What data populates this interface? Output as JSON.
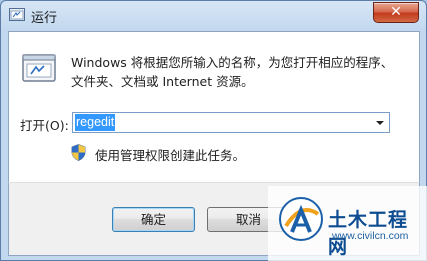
{
  "window": {
    "title": "运行",
    "icon": "run-icon",
    "close_glyph": "✕"
  },
  "content": {
    "description_line1": "Windows 将根据您所输入的名称，为您打开相应的程序、",
    "description_line2": "文件夹、文档或 Internet 资源。",
    "open_label": "打开(O):",
    "open_value": "regedit",
    "admin_note": "使用管理权限创建此任务。"
  },
  "buttons": {
    "ok_label": "确定",
    "cancel_label": "取消"
  },
  "watermark": {
    "title": "土木工程网",
    "url": "www.civilcn.com"
  },
  "colors": {
    "selection": "#3399ff",
    "close_button": "#c23a1b",
    "watermark_blue": "#0d4c91"
  }
}
